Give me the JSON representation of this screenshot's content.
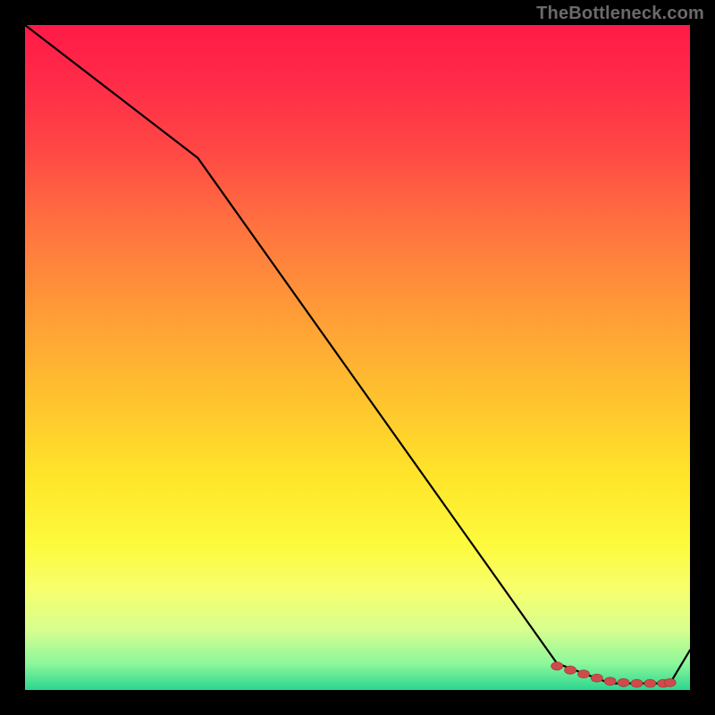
{
  "watermark": "TheBottleneck.com",
  "colors": {
    "line": "#000000",
    "marker_fill": "#cf4b4b",
    "marker_stroke": "#a83a3a",
    "plot_border": "#000000"
  },
  "chart_data": {
    "type": "line",
    "title": "",
    "xlabel": "",
    "ylabel": "",
    "xlim": [
      0,
      100
    ],
    "ylim": [
      0,
      100
    ],
    "grid": false,
    "series": [
      {
        "name": "curve",
        "x": [
          0,
          26,
          80,
          88,
          97,
          100
        ],
        "y": [
          100,
          80,
          4,
          1,
          1,
          6
        ]
      }
    ],
    "markers": {
      "name": "optimum-region",
      "x": [
        80,
        82,
        84,
        86,
        88,
        90,
        92,
        94,
        96,
        97
      ],
      "y": [
        3.6,
        3.0,
        2.4,
        1.8,
        1.3,
        1.1,
        1.0,
        1.0,
        1.0,
        1.1
      ]
    }
  }
}
